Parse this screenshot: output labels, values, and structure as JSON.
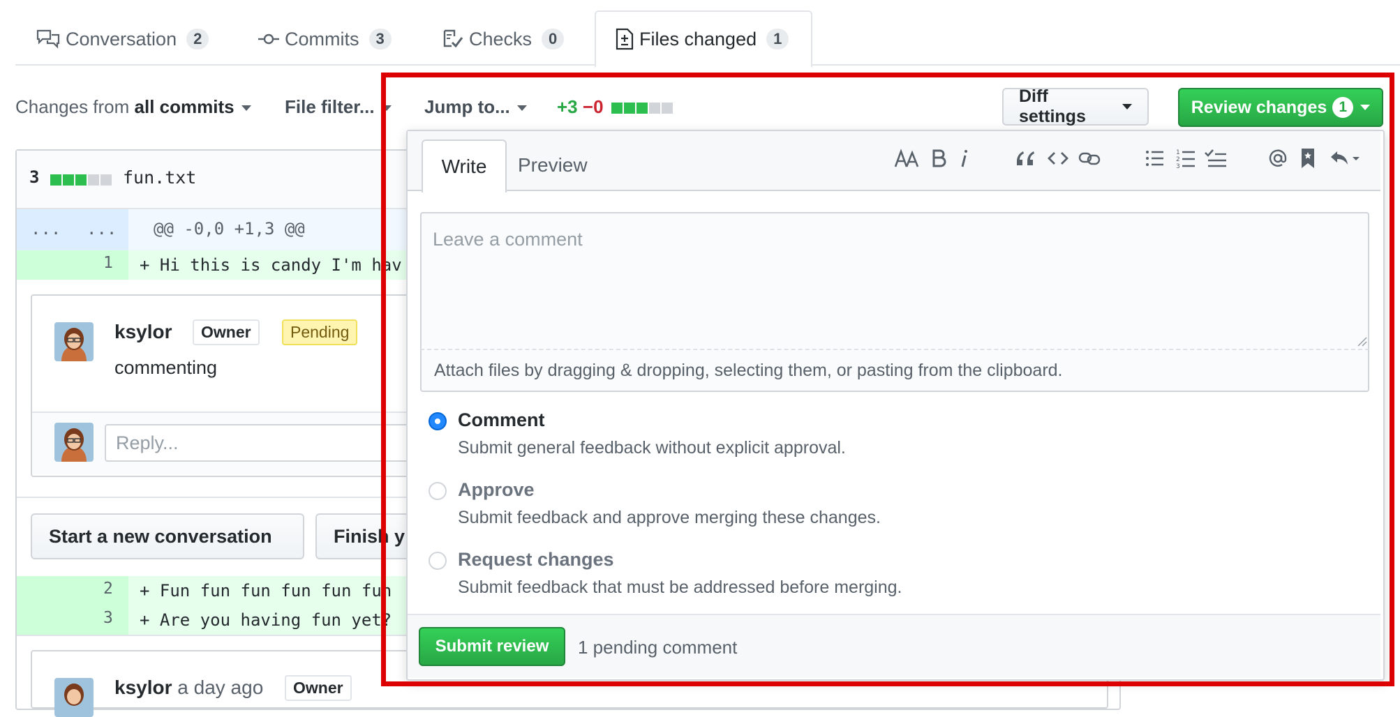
{
  "tabs": [
    {
      "label": "Conversation",
      "count": "2",
      "icon": "comment-discussion-icon"
    },
    {
      "label": "Commits",
      "count": "3",
      "icon": "git-commit-icon"
    },
    {
      "label": "Checks",
      "count": "0",
      "icon": "checklist-icon"
    },
    {
      "label": "Files changed",
      "count": "1",
      "icon": "file-diff-icon"
    }
  ],
  "toolbar": {
    "changes_prefix": "Changes from",
    "changes_value": "all commits",
    "file_filter": "File filter...",
    "jump_to": "Jump to...",
    "additions": "+3",
    "deletions": "−0",
    "diff_settings": "Diff settings",
    "review_changes": "Review changes",
    "review_count": "1"
  },
  "file": {
    "count": "3",
    "name": "fun.txt",
    "hunk_left": "...",
    "hunk_right": "...",
    "hunk_header": "@@ -0,0 +1,3 @@",
    "lines": [
      {
        "num": "1",
        "text": "+ Hi this is candy I'm hav"
      },
      {
        "num": "2",
        "text": "+ Fun fun fun fun fun fun"
      },
      {
        "num": "3",
        "text": "+ Are you having fun yet?"
      }
    ]
  },
  "comment": {
    "author": "ksylor",
    "owner_badge": "Owner",
    "pending_badge": "Pending",
    "body": "commenting",
    "reply_placeholder": "Reply..."
  },
  "actions": {
    "new_conversation": "Start a new conversation",
    "finish": "Finish y"
  },
  "comment2": {
    "author": "ksylor",
    "time": "a day ago",
    "owner_badge": "Owner"
  },
  "review": {
    "write_tab": "Write",
    "preview_tab": "Preview",
    "textarea_placeholder": "Leave a comment",
    "attach_text": "Attach files by dragging & dropping, selecting them, or pasting from the clipboard.",
    "options": [
      {
        "title": "Comment",
        "desc": "Submit general feedback without explicit approval.",
        "selected": true
      },
      {
        "title": "Approve",
        "desc": "Submit feedback and approve merging these changes.",
        "selected": false
      },
      {
        "title": "Request changes",
        "desc": "Submit feedback that must be addressed before merging.",
        "selected": false
      }
    ],
    "submit": "Submit review",
    "pending_note": "1 pending comment"
  },
  "colors": {
    "green": "#28a745",
    "red": "#cb2431",
    "highlight_frame": "#dd0000",
    "radio_selected": "#2188ff"
  }
}
